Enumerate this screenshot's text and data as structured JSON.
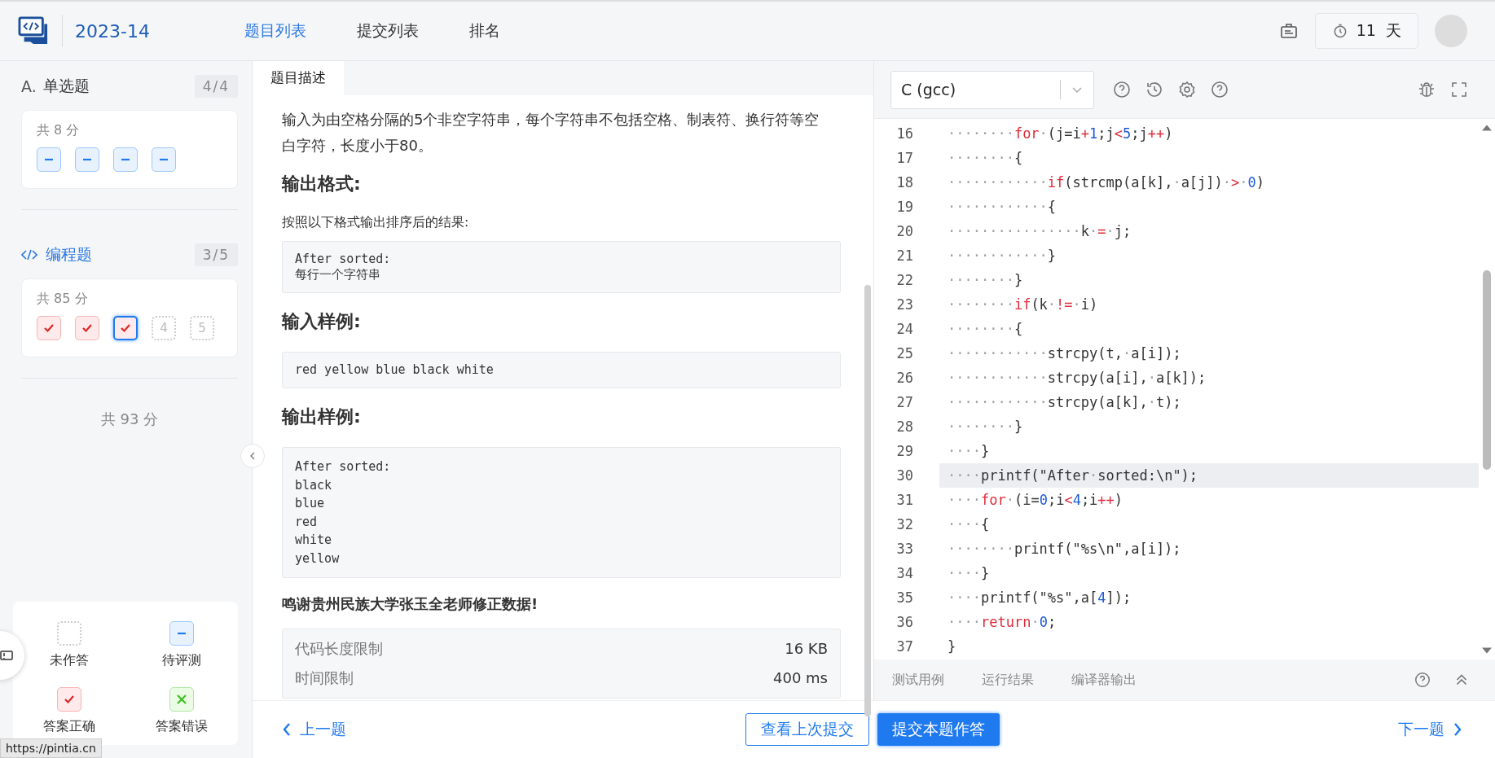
{
  "header": {
    "title": "2023-14",
    "nav": [
      {
        "label": "题目列表",
        "selected": true
      },
      {
        "label": "提交列表",
        "selected": false
      },
      {
        "label": "排名",
        "selected": false
      }
    ],
    "timer": "11  天"
  },
  "sidebar": {
    "sections": [
      {
        "kind": "choice",
        "marker": "A.",
        "title": "单选题",
        "count": "4/4",
        "selected": false,
        "score": "共 8 分",
        "problems": [
          {
            "kind": "pending",
            "selected": false
          },
          {
            "kind": "pending",
            "selected": false
          },
          {
            "kind": "pending",
            "selected": false
          },
          {
            "kind": "pending",
            "selected": false
          }
        ]
      },
      {
        "kind": "code",
        "title": "编程题",
        "count": "3/5",
        "selected": true,
        "score": "共 85 分",
        "problems": [
          {
            "kind": "correct",
            "selected": false
          },
          {
            "kind": "correct",
            "selected": false
          },
          {
            "kind": "correct",
            "selected": true
          },
          {
            "kind": "unanswered",
            "label": "4",
            "selected": false
          },
          {
            "kind": "unanswered",
            "label": "5",
            "selected": false
          }
        ]
      }
    ],
    "total": "共 93 分",
    "legend": [
      {
        "kind": "unanswered",
        "label": "未作答"
      },
      {
        "kind": "pending",
        "label": "待评测"
      },
      {
        "kind": "correct",
        "label": "答案正确"
      },
      {
        "kind": "wrong",
        "label": "答案错误"
      }
    ]
  },
  "description": {
    "tab": "题目描述",
    "blocks": [
      {
        "kind": "text",
        "text": "输入为由空格分隔的5个非空字符串，每个字符串不包括空格、制表符、换行符等空白字符，长度小于80。"
      },
      {
        "kind": "heading",
        "text": "输出格式:"
      },
      {
        "kind": "small",
        "text": "按照以下格式输出排序后的结果:"
      },
      {
        "kind": "code",
        "lines": [
          "After sorted:",
          "每行一个字符串"
        ]
      },
      {
        "kind": "heading",
        "text": "输入样例:"
      },
      {
        "kind": "code",
        "lines": [
          "red yellow blue black white"
        ]
      },
      {
        "kind": "heading",
        "text": "输出样例:"
      },
      {
        "kind": "code",
        "lines": [
          "After sorted:",
          "black",
          "blue",
          "red",
          "white",
          "yellow"
        ]
      },
      {
        "kind": "bold",
        "text": "鸣谢贵州民族大学张玉全老师修正数据!"
      },
      {
        "kind": "limits",
        "rows": [
          {
            "label": "代码长度限制",
            "value": "16 KB"
          },
          {
            "label": "时间限制",
            "value": "400 ms"
          }
        ]
      }
    ]
  },
  "editor": {
    "language": "C (gcc)",
    "lines": [
      {
        "number": "16",
        "highlighted": false,
        "tokens": [
          {
            "kind": "ws",
            "text": "········"
          },
          {
            "kind": "kw",
            "text": "for"
          },
          {
            "kind": "ws",
            "text": "·"
          },
          {
            "kind": "text",
            "text": "(j=i"
          },
          {
            "kind": "op",
            "text": "+"
          },
          {
            "kind": "num",
            "text": "1"
          },
          {
            "kind": "text",
            "text": ";j"
          },
          {
            "kind": "op",
            "text": "<"
          },
          {
            "kind": "num",
            "text": "5"
          },
          {
            "kind": "text",
            "text": ";j"
          },
          {
            "kind": "op",
            "text": "++"
          },
          {
            "kind": "text",
            "text": ")"
          }
        ]
      },
      {
        "number": "17",
        "highlighted": false,
        "tokens": [
          {
            "kind": "ws",
            "text": "········"
          },
          {
            "kind": "text",
            "text": "{"
          }
        ]
      },
      {
        "number": "18",
        "highlighted": false,
        "tokens": [
          {
            "kind": "ws",
            "text": "············"
          },
          {
            "kind": "kw",
            "text": "if"
          },
          {
            "kind": "text",
            "text": "(strcmp(a[k],"
          },
          {
            "kind": "ws",
            "text": "·"
          },
          {
            "kind": "text",
            "text": "a[j])"
          },
          {
            "kind": "ws",
            "text": "·"
          },
          {
            "kind": "op",
            "text": ">"
          },
          {
            "kind": "ws",
            "text": "·"
          },
          {
            "kind": "num",
            "text": "0"
          },
          {
            "kind": "text",
            "text": ")"
          }
        ]
      },
      {
        "number": "19",
        "highlighted": false,
        "tokens": [
          {
            "kind": "ws",
            "text": "············"
          },
          {
            "kind": "text",
            "text": "{"
          }
        ]
      },
      {
        "number": "20",
        "highlighted": false,
        "tokens": [
          {
            "kind": "ws",
            "text": "················"
          },
          {
            "kind": "text",
            "text": "k"
          },
          {
            "kind": "ws",
            "text": "·"
          },
          {
            "kind": "op",
            "text": "="
          },
          {
            "kind": "ws",
            "text": "·"
          },
          {
            "kind": "text",
            "text": "j;"
          }
        ]
      },
      {
        "number": "21",
        "highlighted": false,
        "tokens": [
          {
            "kind": "ws",
            "text": "············"
          },
          {
            "kind": "text",
            "text": "}"
          }
        ]
      },
      {
        "number": "22",
        "highlighted": false,
        "tokens": [
          {
            "kind": "ws",
            "text": "········"
          },
          {
            "kind": "text",
            "text": "}"
          }
        ]
      },
      {
        "number": "23",
        "highlighted": false,
        "tokens": [
          {
            "kind": "ws",
            "text": "········"
          },
          {
            "kind": "kw",
            "text": "if"
          },
          {
            "kind": "text",
            "text": "(k"
          },
          {
            "kind": "ws",
            "text": "·"
          },
          {
            "kind": "op",
            "text": "!="
          },
          {
            "kind": "ws",
            "text": "·"
          },
          {
            "kind": "text",
            "text": "i)"
          }
        ]
      },
      {
        "number": "24",
        "highlighted": false,
        "tokens": [
          {
            "kind": "ws",
            "text": "········"
          },
          {
            "kind": "text",
            "text": "{"
          }
        ]
      },
      {
        "number": "25",
        "highlighted": false,
        "tokens": [
          {
            "kind": "ws",
            "text": "············"
          },
          {
            "kind": "text",
            "text": "strcpy(t,"
          },
          {
            "kind": "ws",
            "text": "·"
          },
          {
            "kind": "text",
            "text": "a[i]);"
          }
        ]
      },
      {
        "number": "26",
        "highlighted": false,
        "tokens": [
          {
            "kind": "ws",
            "text": "············"
          },
          {
            "kind": "text",
            "text": "strcpy(a[i],"
          },
          {
            "kind": "ws",
            "text": "·"
          },
          {
            "kind": "text",
            "text": "a[k]);"
          }
        ]
      },
      {
        "number": "27",
        "highlighted": false,
        "tokens": [
          {
            "kind": "ws",
            "text": "············"
          },
          {
            "kind": "text",
            "text": "strcpy(a[k],"
          },
          {
            "kind": "ws",
            "text": "·"
          },
          {
            "kind": "text",
            "text": "t);"
          }
        ]
      },
      {
        "number": "28",
        "highlighted": false,
        "tokens": [
          {
            "kind": "ws",
            "text": "········"
          },
          {
            "kind": "text",
            "text": "}"
          }
        ]
      },
      {
        "number": "29",
        "highlighted": false,
        "tokens": [
          {
            "kind": "ws",
            "text": "····"
          },
          {
            "kind": "text",
            "text": "}"
          }
        ]
      },
      {
        "number": "30",
        "highlighted": true,
        "tokens": [
          {
            "kind": "ws",
            "text": "····"
          },
          {
            "kind": "text",
            "text": "printf(\"After"
          },
          {
            "kind": "ws",
            "text": "·"
          },
          {
            "kind": "text",
            "text": "sorted:\\n\");"
          }
        ]
      },
      {
        "number": "31",
        "highlighted": false,
        "tokens": [
          {
            "kind": "ws",
            "text": "····"
          },
          {
            "kind": "kw",
            "text": "for"
          },
          {
            "kind": "ws",
            "text": "·"
          },
          {
            "kind": "text",
            "text": "(i="
          },
          {
            "kind": "num",
            "text": "0"
          },
          {
            "kind": "text",
            "text": ";i"
          },
          {
            "kind": "op",
            "text": "<"
          },
          {
            "kind": "num",
            "text": "4"
          },
          {
            "kind": "text",
            "text": ";i"
          },
          {
            "kind": "op",
            "text": "++"
          },
          {
            "kind": "text",
            "text": ")"
          }
        ]
      },
      {
        "number": "32",
        "highlighted": false,
        "tokens": [
          {
            "kind": "ws",
            "text": "····"
          },
          {
            "kind": "text",
            "text": "{"
          }
        ]
      },
      {
        "number": "33",
        "highlighted": false,
        "tokens": [
          {
            "kind": "ws",
            "text": "········"
          },
          {
            "kind": "text",
            "text": "printf(\"%s\\n\",a[i]);"
          }
        ]
      },
      {
        "number": "34",
        "highlighted": false,
        "tokens": [
          {
            "kind": "ws",
            "text": "····"
          },
          {
            "kind": "text",
            "text": "}"
          }
        ]
      },
      {
        "number": "35",
        "highlighted": false,
        "tokens": [
          {
            "kind": "ws",
            "text": "····"
          },
          {
            "kind": "text",
            "text": "printf(\"%s\",a["
          },
          {
            "kind": "num",
            "text": "4"
          },
          {
            "kind": "text",
            "text": "]);"
          }
        ]
      },
      {
        "number": "36",
        "highlighted": false,
        "tokens": [
          {
            "kind": "ws",
            "text": "····"
          },
          {
            "kind": "kw",
            "text": "return"
          },
          {
            "kind": "ws",
            "text": "·"
          },
          {
            "kind": "num",
            "text": "0"
          },
          {
            "kind": "text",
            "text": ";"
          }
        ]
      },
      {
        "number": "37",
        "highlighted": false,
        "tokens": [
          {
            "kind": "text",
            "text": "}"
          }
        ]
      }
    ],
    "bottom_tabs": [
      {
        "label": "测试用例",
        "selected": false
      },
      {
        "label": "运行结果",
        "selected": false
      },
      {
        "label": "编译器输出",
        "selected": false
      }
    ]
  },
  "footer": {
    "prev": "上一题",
    "view_last": "查看上次提交",
    "submit": "提交本题作答",
    "next": "下一题"
  },
  "status_url": "https://pintia.cn"
}
